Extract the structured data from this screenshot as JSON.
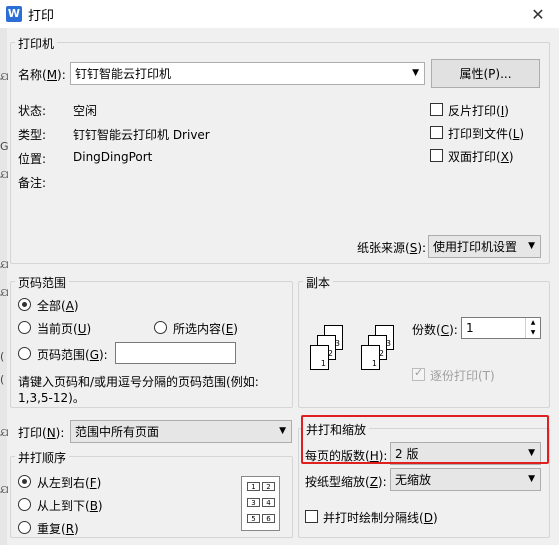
{
  "window": {
    "app_icon_letter": "W",
    "title": "打印"
  },
  "left_strip_glyphs": [
    "ଯ",
    "G",
    "ଯ",
    "ଯ",
    "ଯ",
    "(",
    "(",
    "ଯ",
    "ଯ"
  ],
  "printer": {
    "group_title": "打印机",
    "name_label": "名称(",
    "name_key": "M",
    "name_label_end": "):",
    "name_value": "钉钉智能云打印机",
    "properties_button": "属性(P)...",
    "status_label": "状态:",
    "status_value": "空闲",
    "type_label": "类型:",
    "type_value": "钉钉智能云打印机 Driver",
    "where_label": "位置:",
    "where_value": "DingDingPort",
    "comment_label": "备注:",
    "options": [
      {
        "label": "反片打印(",
        "key": "I",
        "end": ")",
        "checked": false
      },
      {
        "label": "打印到文件(",
        "key": "L",
        "end": ")",
        "checked": false
      },
      {
        "label": "双面打印(",
        "key": "X",
        "end": ")",
        "checked": false
      }
    ],
    "paper_source_label": "纸张来源(",
    "paper_source_key": "S",
    "paper_source_end": "):",
    "paper_source_value": "使用打印机设置"
  },
  "page_range": {
    "group_title": "页码范围",
    "all": {
      "label": "全部(",
      "key": "A",
      "end": ")",
      "selected": true
    },
    "current": {
      "label": "当前页(",
      "key": "U",
      "end": ")",
      "selected": false
    },
    "selection": {
      "label": "所选内容(",
      "key": "E",
      "end": ")",
      "selected": false
    },
    "pages": {
      "label": "页码范围(",
      "key": "G",
      "end": "):",
      "selected": false,
      "value": ""
    },
    "hint_line1": "请键入页码和/或用逗号分隔的页码范围(例如:",
    "hint_line2": "1,3,5-12)。"
  },
  "copies": {
    "group_title": "副本",
    "count_label": "份数(",
    "count_key": "C",
    "count_end": "):",
    "count_value": "1",
    "collate_label": "逐份打印(T)",
    "collate_checked": true,
    "page_numbers": [
      "3",
      "2",
      "1",
      "3",
      "2",
      "1"
    ]
  },
  "print_what": {
    "label": "打印(",
    "key": "N",
    "end": "):",
    "value": "范围中所有页面"
  },
  "collate_order": {
    "group_title": "并打顺序",
    "options": [
      {
        "label": "从左到右(",
        "key": "F",
        "end": ")",
        "selected": true
      },
      {
        "label": "从上到下(",
        "key": "B",
        "end": ")",
        "selected": false
      },
      {
        "label": "重复(",
        "key": "R",
        "end": ")",
        "selected": false
      }
    ],
    "diagram_numbers": [
      "1",
      "2",
      "3",
      "4",
      "5",
      "6"
    ]
  },
  "zoom": {
    "group_title": "并打和缩放",
    "pages_per_sheet_label": "每页的版数(",
    "pages_per_sheet_key": "H",
    "pages_per_sheet_end": "):",
    "pages_per_sheet_value": "2 版",
    "scale_label": "按纸型缩放(",
    "scale_key": "Z",
    "scale_end": "):",
    "scale_value": "无缩放",
    "divider_label": "并打时绘制分隔线(",
    "divider_key": "D",
    "divider_end": ")",
    "divider_checked": false
  },
  "colors": {
    "highlight": "#e02020",
    "accent": "#2b6fd6"
  }
}
